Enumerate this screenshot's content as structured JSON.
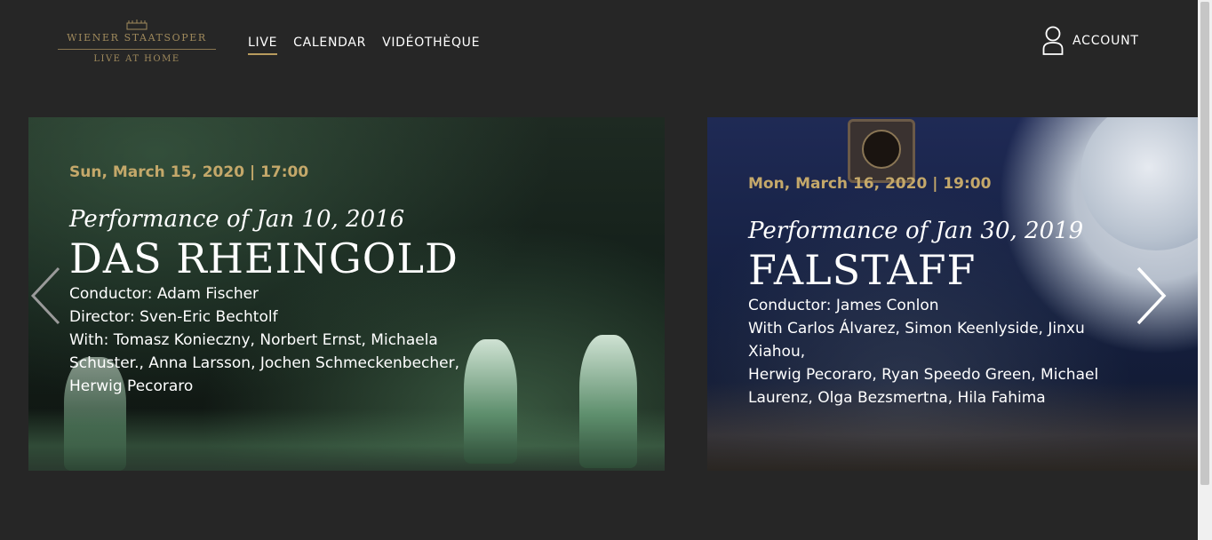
{
  "brand": {
    "line1": "WIENER STAATSOPER",
    "line2": "LIVE AT HOME",
    "color": "#a08a5c"
  },
  "nav": {
    "items": [
      {
        "label": "LIVE",
        "active": true
      },
      {
        "label": "CALENDAR",
        "active": false
      },
      {
        "label": "VIDÉOTHÈQUE",
        "active": false
      }
    ],
    "accent": "#b89b5e"
  },
  "account": {
    "label": "ACCOUNT",
    "icon": "user-icon"
  },
  "slides": [
    {
      "date": "Sun, March 15, 2020 | 17:00",
      "performance": "Performance of Jan 10, 2016",
      "title": "DAS RHEINGOLD",
      "lines": [
        "Conductor: Adam Fischer",
        "Director: Sven-Eric Bechtolf",
        "With: Tomasz Konieczny, Norbert Ernst, Michaela",
        "Schuster., Anna Larsson, Jochen Schmeckenbecher,",
        "Herwig Pecoraro"
      ]
    },
    {
      "date": "Mon, March 16, 2020 | 19:00",
      "performance": "Performance of Jan 30, 2019",
      "title": "FALSTAFF",
      "lines": [
        "Conductor: James Conlon",
        "With Carlos Álvarez, Simon Keenlyside, Jinxu Xiahou,",
        "Herwig Pecoraro, Ryan Speedo Green, Michael",
        "Laurenz, Olga Bezsmertna, Hila Fahima"
      ]
    }
  ],
  "date_color": "#c4a86a",
  "arrows": {
    "prev": "chevron-left-icon",
    "next": "chevron-right-icon"
  }
}
